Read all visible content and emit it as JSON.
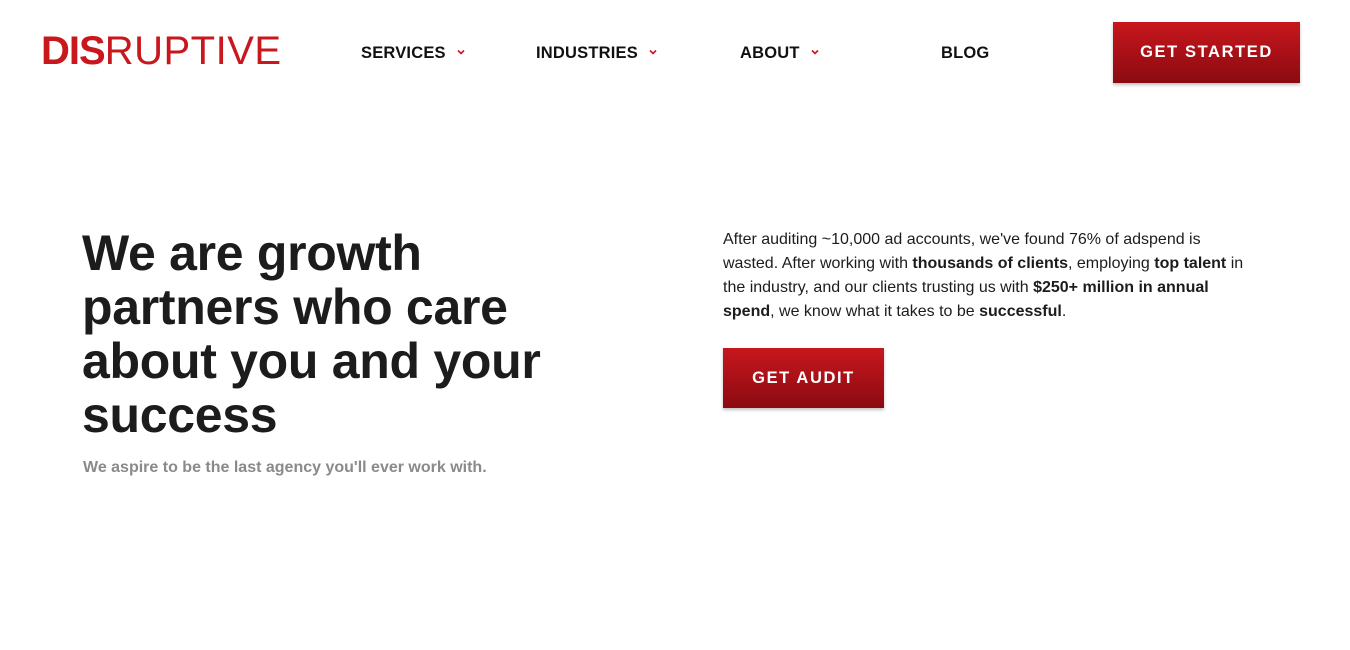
{
  "brand": {
    "logo_strong": "DIS",
    "logo_light": "RUPTIVE",
    "accent_color": "#c8171d"
  },
  "nav": {
    "items": [
      {
        "label": "SERVICES",
        "has_dropdown": true
      },
      {
        "label": "INDUSTRIES",
        "has_dropdown": true
      },
      {
        "label": "ABOUT",
        "has_dropdown": true
      },
      {
        "label": "BLOG",
        "has_dropdown": false
      }
    ],
    "cta_label": "GET STARTED"
  },
  "hero": {
    "title": "We are growth partners who care about you and your success",
    "subtitle": "We aspire to be the last agency you'll ever work with.",
    "description": {
      "p1": "After auditing ~10,000 ad accounts, we've found 76% of adspend is wasted. After working with ",
      "b1": "thousands of clients",
      "p2": ", employing ",
      "b2": "top talent",
      "p3": " in the industry, and our clients trusting us with ",
      "b3": "$250+ million in annual spend",
      "p4": ", we know what it takes to be ",
      "b4": "successful",
      "p5": "."
    },
    "cta_label": "GET AUDIT"
  }
}
